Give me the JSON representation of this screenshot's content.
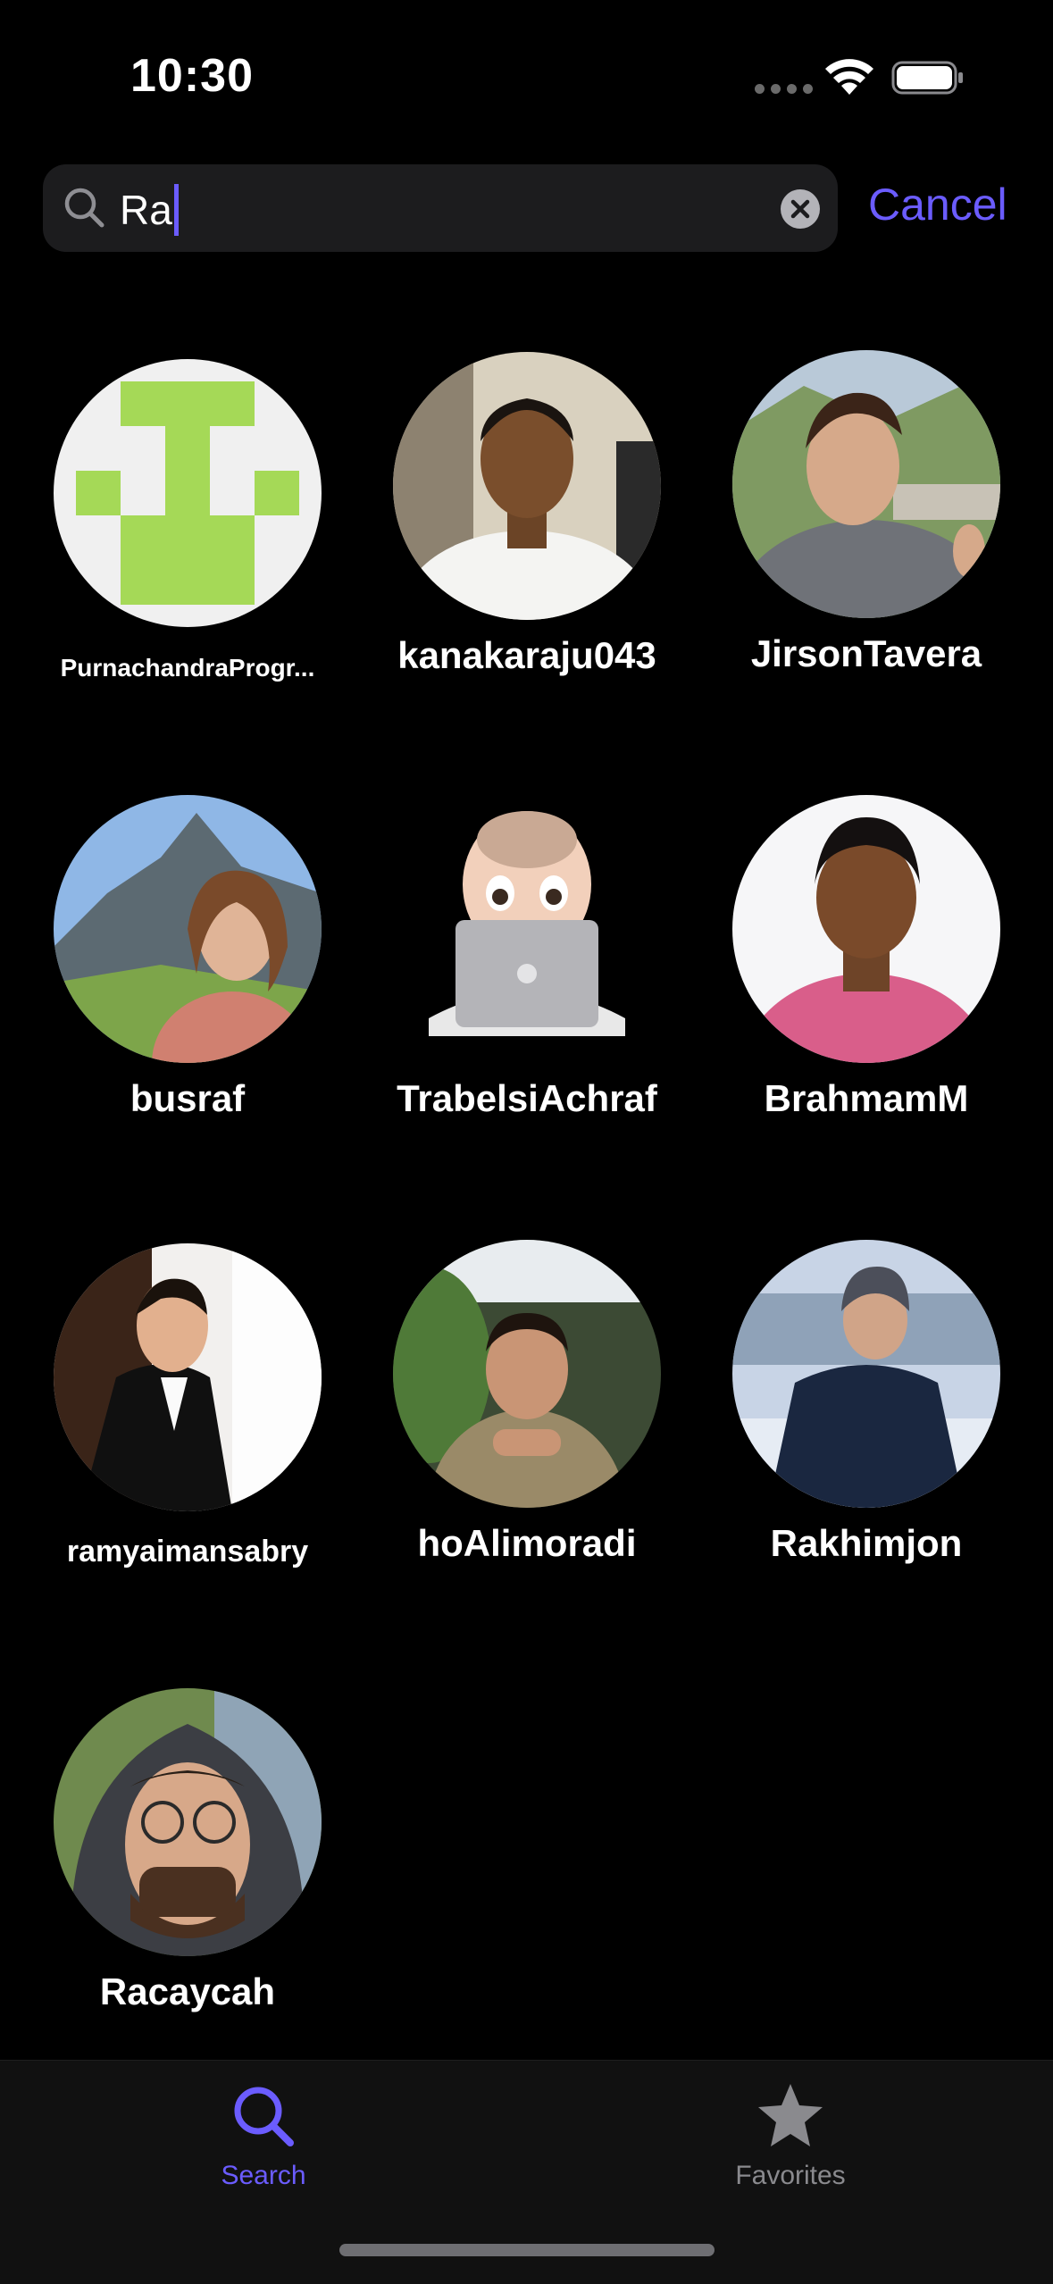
{
  "status_bar": {
    "time": "10:30"
  },
  "search": {
    "value": "Ra",
    "placeholder": "",
    "cancel_label": "Cancel"
  },
  "accent_color": "#6b5cff",
  "results": [
    {
      "username": "PurnachandraProgr...",
      "avatar": "identicon-green"
    },
    {
      "username": "kanakaraju043",
      "avatar": "photo-man-white-shirt"
    },
    {
      "username": "JirsonTavera",
      "avatar": "photo-man-selfie-hills"
    },
    {
      "username": "busraf",
      "avatar": "photo-woman-mountains"
    },
    {
      "username": "TrabelsiAchraf",
      "avatar": "memoji-laptop"
    },
    {
      "username": "BrahmamM",
      "avatar": "photo-man-pink-shirt"
    },
    {
      "username": "ramyaimansabry",
      "avatar": "photo-man-tuxedo"
    },
    {
      "username": "hoAlimoradi",
      "avatar": "photo-man-glasses-cafe"
    },
    {
      "username": "Rakhimjon",
      "avatar": "photo-man-snow"
    },
    {
      "username": "Racaycah",
      "avatar": "photo-man-hood-glasses"
    }
  ],
  "tabs": [
    {
      "label": "Search",
      "icon": "search-icon",
      "active": true
    },
    {
      "label": "Favorites",
      "icon": "star-icon",
      "active": false
    }
  ]
}
